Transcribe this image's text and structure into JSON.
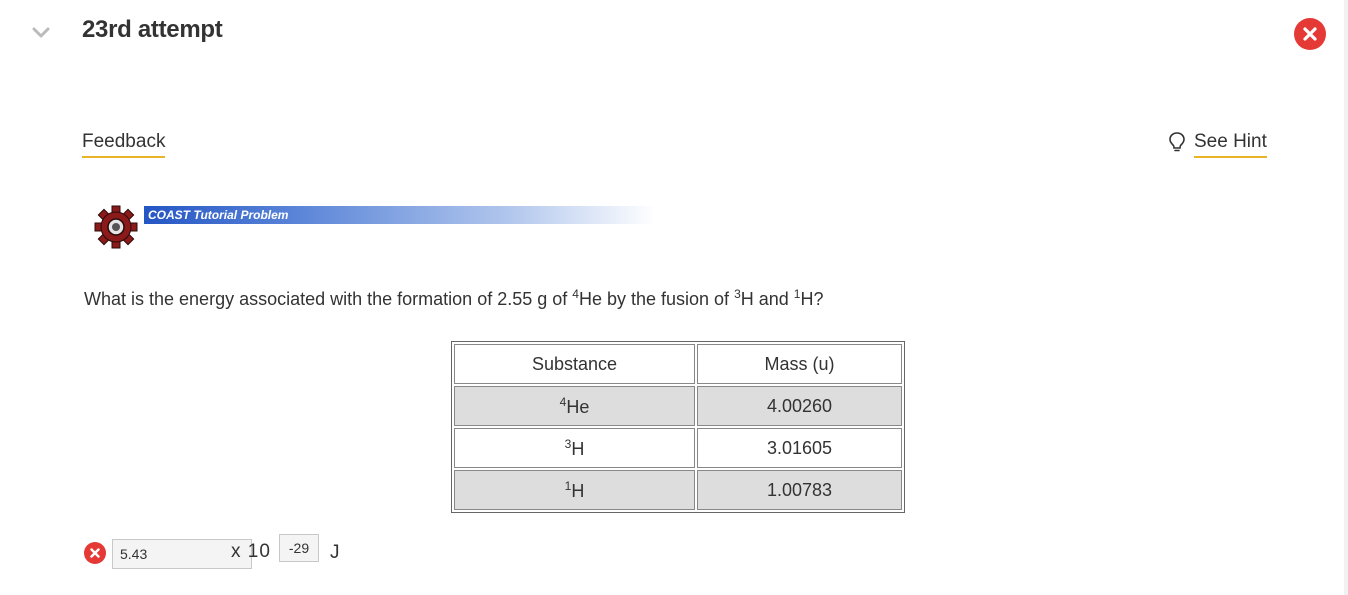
{
  "header": {
    "attempt_title": "23rd attempt"
  },
  "links": {
    "feedback": "Feedback",
    "see_hint": "See Hint"
  },
  "banner": {
    "label": "COAST Tutorial Problem"
  },
  "question": {
    "part1": "What is the energy associated with the formation of 2.55 g of ",
    "he_sup": "4",
    "part2": "He by the fusion of ",
    "h3_sup": "3",
    "part3": "H and ",
    "h1_sup": "1",
    "part4": "H?"
  },
  "table": {
    "headers": [
      "Substance",
      "Mass (u)"
    ],
    "rows": [
      {
        "sup": "4",
        "element": "He",
        "mass": "4.00260"
      },
      {
        "sup": "3",
        "element": "H",
        "mass": "3.01605"
      },
      {
        "sup": "1",
        "element": "H",
        "mass": "1.00783"
      }
    ]
  },
  "answer": {
    "value": "5.43",
    "times_ten": "x 10",
    "exponent": "-29",
    "unit": "J",
    "status": "incorrect"
  },
  "icons": {
    "chevron": "chevron-down-icon",
    "close": "close-icon",
    "hint": "lightbulb-icon",
    "gear": "gear-icon",
    "incorrect": "incorrect-icon"
  },
  "colors": {
    "error": "#e53935",
    "underline_accent": "#e8b52a",
    "banner_blue": "#2456c4",
    "table_shade": "#dddddd"
  }
}
